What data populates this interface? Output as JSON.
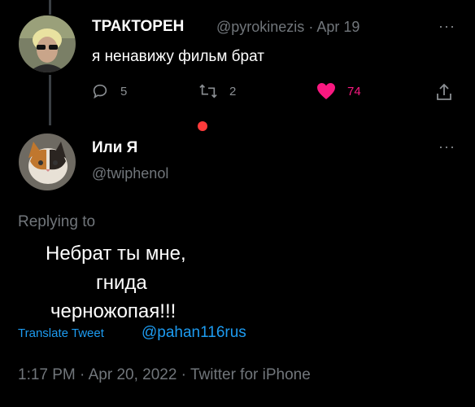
{
  "tweet1": {
    "name": "ТРАКТОРЕН",
    "handle": "@pyrokinezis",
    "sep": "·",
    "date": "Apr 19",
    "text": "я ненавижу фильм брат",
    "more": "···",
    "replies": "5",
    "retweets": "2",
    "likes": "74",
    "icons": [
      "reply-icon",
      "retweet-icon",
      "heart-icon",
      "share-icon"
    ],
    "like_color": "#f91880"
  },
  "tweet2": {
    "name": "Или Я",
    "handle": "@twiphenol",
    "more": "···",
    "replying_to": "Replying to",
    "text_lines": [
      "Небрат ты мне,",
      "гнида",
      "черножопая!!!"
    ],
    "translate": "Translate Tweet",
    "mention": "@pahan116rus",
    "footer": "1:17 PM · Apr 20, 2022 · Twitter for iPhone"
  },
  "colors": {
    "background": "#000000",
    "link": "#1d9bf0",
    "muted": "#71767b",
    "dot": "#ff3b3b"
  }
}
